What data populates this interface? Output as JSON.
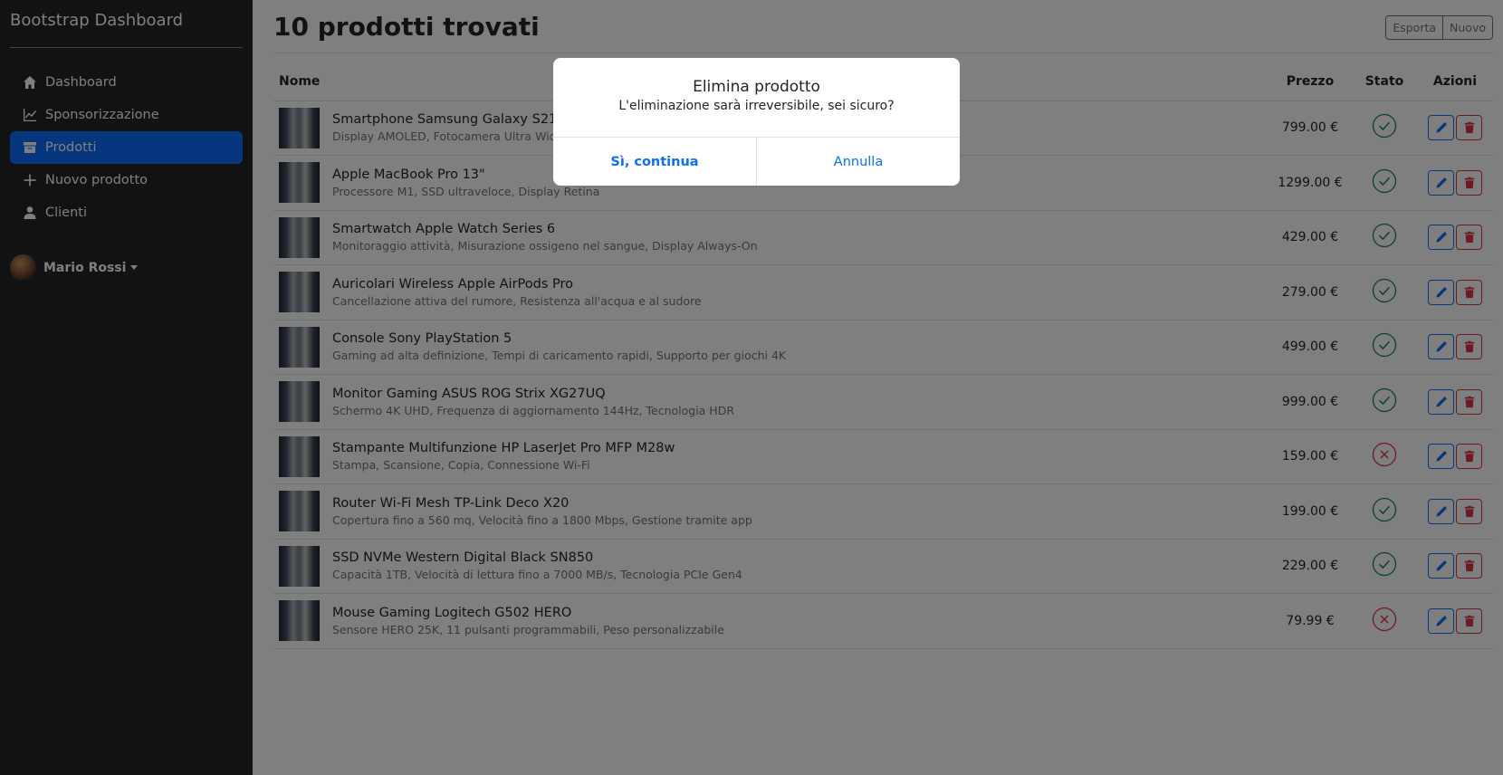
{
  "sidebar": {
    "brand": "Bootstrap Dashboard",
    "items": [
      {
        "label": "Dashboard",
        "icon": "home-icon",
        "active": false
      },
      {
        "label": "Sponsorizzazione",
        "icon": "chart-line-icon",
        "active": false
      },
      {
        "label": "Prodotti",
        "icon": "archive-icon",
        "active": true
      },
      {
        "label": "Nuovo prodotto",
        "icon": "plus-icon",
        "active": false
      },
      {
        "label": "Clienti",
        "icon": "person-icon",
        "active": false
      }
    ],
    "user": {
      "name": "Mario Rossi"
    }
  },
  "header": {
    "title": "10 prodotti trovati",
    "export_label": "Esporta",
    "new_label": "Nuovo"
  },
  "table": {
    "columns": {
      "name": "Nome",
      "price": "Prezzo",
      "status": "Stato",
      "actions": "Azioni"
    },
    "rows": [
      {
        "name": "Smartphone Samsung Galaxy S21",
        "desc": "Display AMOLED, Fotocamera Ultra Wide, B",
        "price": "799.00 €",
        "status": "active"
      },
      {
        "name": "Apple MacBook Pro 13\"",
        "desc": "Processore M1, SSD ultraveloce, Display Retina",
        "price": "1299.00 €",
        "status": "active"
      },
      {
        "name": "Smartwatch Apple Watch Series 6",
        "desc": "Monitoraggio attività, Misurazione ossigeno nel sangue, Display Always-On",
        "price": "429.00 €",
        "status": "active"
      },
      {
        "name": "Auricolari Wireless Apple AirPods Pro",
        "desc": "Cancellazione attiva del rumore, Resistenza all'acqua e al sudore",
        "price": "279.00 €",
        "status": "active"
      },
      {
        "name": "Console Sony PlayStation 5",
        "desc": "Gaming ad alta definizione, Tempi di caricamento rapidi, Supporto per giochi 4K",
        "price": "499.00 €",
        "status": "active"
      },
      {
        "name": "Monitor Gaming ASUS ROG Strix XG27UQ",
        "desc": "Schermo 4K UHD, Frequenza di aggiornamento 144Hz, Tecnologia HDR",
        "price": "999.00 €",
        "status": "active"
      },
      {
        "name": "Stampante Multifunzione HP LaserJet Pro MFP M28w",
        "desc": "Stampa, Scansione, Copia, Connessione Wi-Fi",
        "price": "159.00 €",
        "status": "inactive"
      },
      {
        "name": "Router Wi-Fi Mesh TP-Link Deco X20",
        "desc": "Copertura fino a 560 mq, Velocità fino a 1800 Mbps, Gestione tramite app",
        "price": "199.00 €",
        "status": "active"
      },
      {
        "name": "SSD NVMe Western Digital Black SN850",
        "desc": "Capacità 1TB, Velocità di lettura fino a 7000 MB/s, Tecnologia PCIe Gen4",
        "price": "229.00 €",
        "status": "active"
      },
      {
        "name": "Mouse Gaming Logitech G502 HERO",
        "desc": "Sensore HERO 25K, 11 pulsanti programmabili, Peso personalizzabile",
        "price": "79.99 €",
        "status": "inactive"
      }
    ]
  },
  "modal": {
    "title": "Elimina prodotto",
    "text": "L'eliminazione sarà irreversibile, sei sicuro?",
    "confirm_label": "Sì, continua",
    "cancel_label": "Annulla"
  },
  "colors": {
    "sidebar_bg": "#212529",
    "accent": "#0d6efd",
    "success": "#198754",
    "danger": "#dc3545"
  }
}
